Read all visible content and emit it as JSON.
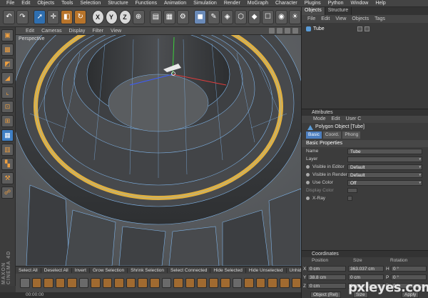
{
  "menubar": {
    "items": [
      "File",
      "Edit",
      "Objects",
      "Tools",
      "Selection",
      "Structure",
      "Functions",
      "Animation",
      "Simulation",
      "Render",
      "MoGraph",
      "Character",
      "Plugins",
      "Python",
      "Window",
      "Help"
    ]
  },
  "toolbar": {
    "axis_x": "X",
    "axis_y": "Y",
    "axis_z": "Z"
  },
  "viewport": {
    "menu": [
      "Edit",
      "Cameras",
      "Display",
      "Filter",
      "View"
    ],
    "label": "Perspective"
  },
  "left_tools": {
    "brand": "MAXON CINEMA 4D"
  },
  "selection_bar": {
    "items": [
      "Select All",
      "Deselect All",
      "Invert",
      "Grow Selection",
      "Shrink Selection",
      "Select Connected",
      "Hide Selected",
      "Hide Unselected",
      "Unhide"
    ]
  },
  "timebar": {
    "time": "00:00:00"
  },
  "objects_panel": {
    "tabs": [
      "Objects",
      "Structure"
    ],
    "menu": [
      "File",
      "Edit",
      "View",
      "Objects",
      "Tags"
    ],
    "objects": [
      {
        "name": "Tube"
      }
    ]
  },
  "attributes": {
    "header": "Attributes",
    "menu": [
      "Mode",
      "Edit",
      "User C"
    ],
    "object_title": "Polygon Object [Tube]",
    "tabs": [
      "Basic",
      "Coord.",
      "Phong"
    ],
    "section": "Basic Properties",
    "props": [
      {
        "label": "Name",
        "value": "Tube",
        "kind": "text"
      },
      {
        "label": "Layer",
        "value": "",
        "kind": "text"
      },
      {
        "label": "Visible in Editor",
        "value": "Default",
        "kind": "select"
      },
      {
        "label": "Visible in Renderer",
        "value": "Default",
        "kind": "select"
      },
      {
        "label": "Use Color",
        "value": "Off",
        "kind": "select"
      },
      {
        "label": "Display Color",
        "value": "",
        "kind": "swatch"
      },
      {
        "label": "X-Ray",
        "value": "",
        "kind": "check"
      }
    ]
  },
  "coordinates": {
    "header": "Coordinates",
    "columns": [
      "Position",
      "Size",
      "Rotation"
    ],
    "rows": [
      {
        "axis": "X",
        "pos": "0 cm",
        "size": "363.037 cm",
        "rot_axis": "H",
        "rot": "0 °"
      },
      {
        "axis": "Y",
        "pos": "38.8 cm",
        "size": "0 cm",
        "rot_axis": "P",
        "rot": "0 °"
      },
      {
        "axis": "Z",
        "pos": "0 cm",
        "size": "0 cm",
        "rot_axis": "B",
        "rot": "0 °"
      }
    ],
    "mode_button": "Object (Rel)",
    "size_button": "Size",
    "apply_button": "Apply"
  },
  "watermark": "pxleyes.com",
  "colors": {
    "selection_edge": "#e0b040",
    "wire": "#7fb4e8",
    "mesh_face": "#3e4043",
    "viewport_bg": "#5f6266"
  }
}
